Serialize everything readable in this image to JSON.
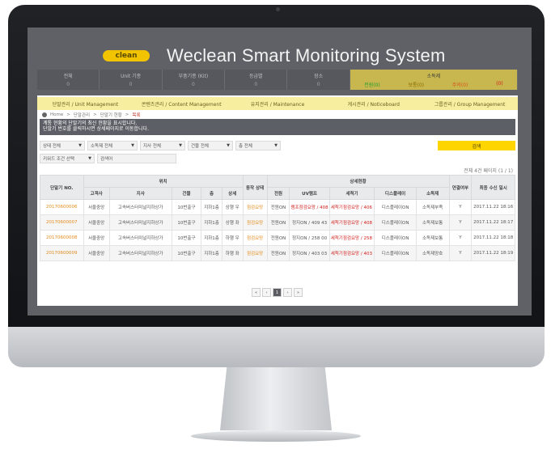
{
  "app": {
    "logo_text": "clean",
    "title": "Weclean Smart Monitoring System"
  },
  "nav": [
    {
      "label": "전체",
      "count": "0"
    },
    {
      "label": "Unit 기종",
      "count": "0"
    },
    {
      "label": "부품기종 (Kit)",
      "count": "0"
    },
    {
      "label": "등급별",
      "count": "0"
    },
    {
      "label": "장소",
      "count": "0"
    }
  ],
  "nav_active": {
    "label": "소독제",
    "statuses": [
      {
        "label": "전원(0)",
        "color": "#1e9d2d"
      },
      {
        "label": "보통(0)",
        "color": "#8a6d00"
      },
      {
        "label": "주의(0)",
        "color": "#d6541a"
      },
      {
        "label": "(0)",
        "color": "#d0201c"
      }
    ]
  },
  "tabs": [
    "단말관리 / Unit Management",
    "콘텐츠관리 / Content Management",
    "유지관리 / Maintenance",
    "게시관리 / Noticeboard",
    "그룹관리 / Group Management"
  ],
  "breadcrumb": {
    "home": "Home",
    "parent": "단말관리",
    "section": "단말기 현황",
    "current": "목록"
  },
  "notice": [
    "계통 현황의 단말기의 최신 현황을 표시합니다.",
    "단말기 번호를 클릭하시면 상세페이지로 이동합니다."
  ],
  "filters": {
    "selects": [
      "상태 전체",
      "소독제 전체",
      "지사 전체",
      "건물 전체",
      "층 전체"
    ],
    "search_button": "검색",
    "keyword_select": "키워드 조건 선택",
    "keyword_placeholder": "검색어"
  },
  "result_count": "전체 4건 페이지 (1 / 1)",
  "table": {
    "group_headers": {
      "location": "위치",
      "detail": "상세현황"
    },
    "columns": {
      "unit_no": "단말기 NO.",
      "client": "고객사",
      "branch": "지사",
      "building": "건물",
      "floor": "층",
      "detail_loc": "상세",
      "status": "동작 상태",
      "power": "전원",
      "uv": "UV램프",
      "sterilizer": "세척기",
      "disinfect": "디스플레이",
      "disinfectant": "소독제",
      "connection": "연결여부",
      "last_time": "최종 수신 일시"
    },
    "rows": [
      {
        "unit_no": "20170600006",
        "client": "서울중앙",
        "branch": "고속버스터미널지하상가",
        "building": "10번출구",
        "floor": "지하1층",
        "detail_loc": "상행 우",
        "status": "점검요망",
        "power": "전원ON",
        "uv": "램프점검요망 / 408 42",
        "sterilizer": "세척기점검요망 / 406 42",
        "disinfect": "디스플레이ON",
        "disinfectant": "소독제부족",
        "connection": "Y",
        "last_time": "2017.11.22 18:16"
      },
      {
        "unit_no": "20170600007",
        "client": "서울중앙",
        "branch": "고속버스터미널지하상가",
        "building": "10번출구",
        "floor": "지하1층",
        "detail_loc": "상행 좌",
        "status": "점검요망",
        "power": "전원ON",
        "uv": "정지ON / 409 43",
        "sterilizer": "세척기점검요망 / 408 42",
        "disinfect": "디스플레이ON",
        "disinfectant": "소독제보통",
        "connection": "Y",
        "last_time": "2017.11.22 18:17"
      },
      {
        "unit_no": "20170600008",
        "client": "서울중앙",
        "branch": "고속버스터미널지하상가",
        "building": "10번출구",
        "floor": "지하1층",
        "detail_loc": "하행 우",
        "status": "점검요망",
        "power": "전원ON",
        "uv": "정지ON / 258 00",
        "sterilizer": "세척기점검요망 / 258 00",
        "disinfect": "디스플레이ON",
        "disinfectant": "소독제보통",
        "connection": "Y",
        "last_time": "2017.11.22 18:18"
      },
      {
        "unit_no": "20170600009",
        "client": "서울중앙",
        "branch": "고속버스터미널지하상가",
        "building": "10번출구",
        "floor": "지하1층",
        "detail_loc": "하행 좌",
        "status": "점검요망",
        "power": "전원ON",
        "uv": "정지ON / 403 03",
        "sterilizer": "세척기점검요망 / 403 03",
        "disinfect": "디스플레이ON",
        "disinfectant": "소독제양호",
        "connection": "Y",
        "last_time": "2017.11.22 18:19"
      }
    ]
  },
  "pager": {
    "first": "«",
    "prev": "‹",
    "current": "1",
    "next": "›",
    "last": "»"
  }
}
